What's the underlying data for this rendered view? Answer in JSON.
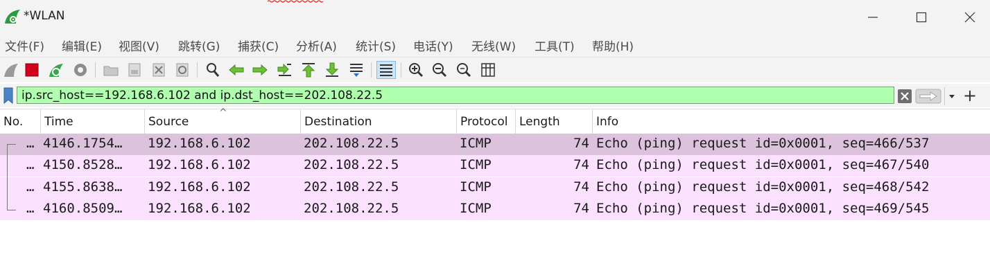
{
  "window": {
    "title": "*WLAN",
    "logo_icon": "wireshark-fin-icon",
    "controls": [
      "minimize-icon",
      "maximize-icon",
      "close-icon"
    ]
  },
  "menu": {
    "items": [
      {
        "label": "文件(F)"
      },
      {
        "label": "编辑(E)"
      },
      {
        "label": "视图(V)"
      },
      {
        "label": "跳转(G)"
      },
      {
        "label": "捕获(C)"
      },
      {
        "label": "分析(A)"
      },
      {
        "label": "统计(S)"
      },
      {
        "label": "电话(Y)"
      },
      {
        "label": "无线(W)"
      },
      {
        "label": "工具(T)"
      },
      {
        "label": "帮助(H)"
      }
    ]
  },
  "toolbar": {
    "icons": [
      "start-capture-icon",
      "stop-capture-icon",
      "restart-capture-icon",
      "capture-options-icon",
      "open-file-icon",
      "save-file-icon",
      "close-file-icon",
      "reload-file-icon",
      "find-packet-icon",
      "go-back-icon",
      "go-forward-icon",
      "go-to-packet-icon",
      "go-first-icon",
      "go-last-icon",
      "autoscroll-icon",
      "colorize-icon",
      "zoom-in-icon",
      "zoom-out-icon",
      "normal-size-icon",
      "resize-columns-icon"
    ],
    "active": "colorize-icon"
  },
  "filter": {
    "value": "ip.src_host==192.168.6.102 and ip.dst_host==202.108.22.5",
    "background": "#afffaf"
  },
  "packet_list": {
    "columns": [
      {
        "label": "No."
      },
      {
        "label": "Time"
      },
      {
        "label": "Source"
      },
      {
        "label": "Destination"
      },
      {
        "label": "Protocol"
      },
      {
        "label": "Length"
      },
      {
        "label": "Info"
      }
    ],
    "sorted_column": "Source",
    "rows": [
      {
        "no": "…",
        "time": "4146.1754…",
        "source": "192.168.6.102",
        "destination": "202.108.22.5",
        "protocol": "ICMP",
        "length": "74",
        "info": "Echo (ping) request  id=0x0001, seq=466/537",
        "selected": true
      },
      {
        "no": "…",
        "time": "4150.8528…",
        "source": "192.168.6.102",
        "destination": "202.108.22.5",
        "protocol": "ICMP",
        "length": "74",
        "info": "Echo (ping) request  id=0x0001, seq=467/540",
        "selected": false
      },
      {
        "no": "…",
        "time": "4155.8638…",
        "source": "192.168.6.102",
        "destination": "202.108.22.5",
        "protocol": "ICMP",
        "length": "74",
        "info": "Echo (ping) request  id=0x0001, seq=468/542",
        "selected": false
      },
      {
        "no": "…",
        "time": "4160.8509…",
        "source": "192.168.6.102",
        "destination": "202.108.22.5",
        "protocol": "ICMP",
        "length": "74",
        "info": "Echo (ping) request  id=0x0001, seq=469/545",
        "selected": false
      }
    ],
    "row_color": "#fce0ff",
    "selected_row_color": "#dcc2dc"
  }
}
